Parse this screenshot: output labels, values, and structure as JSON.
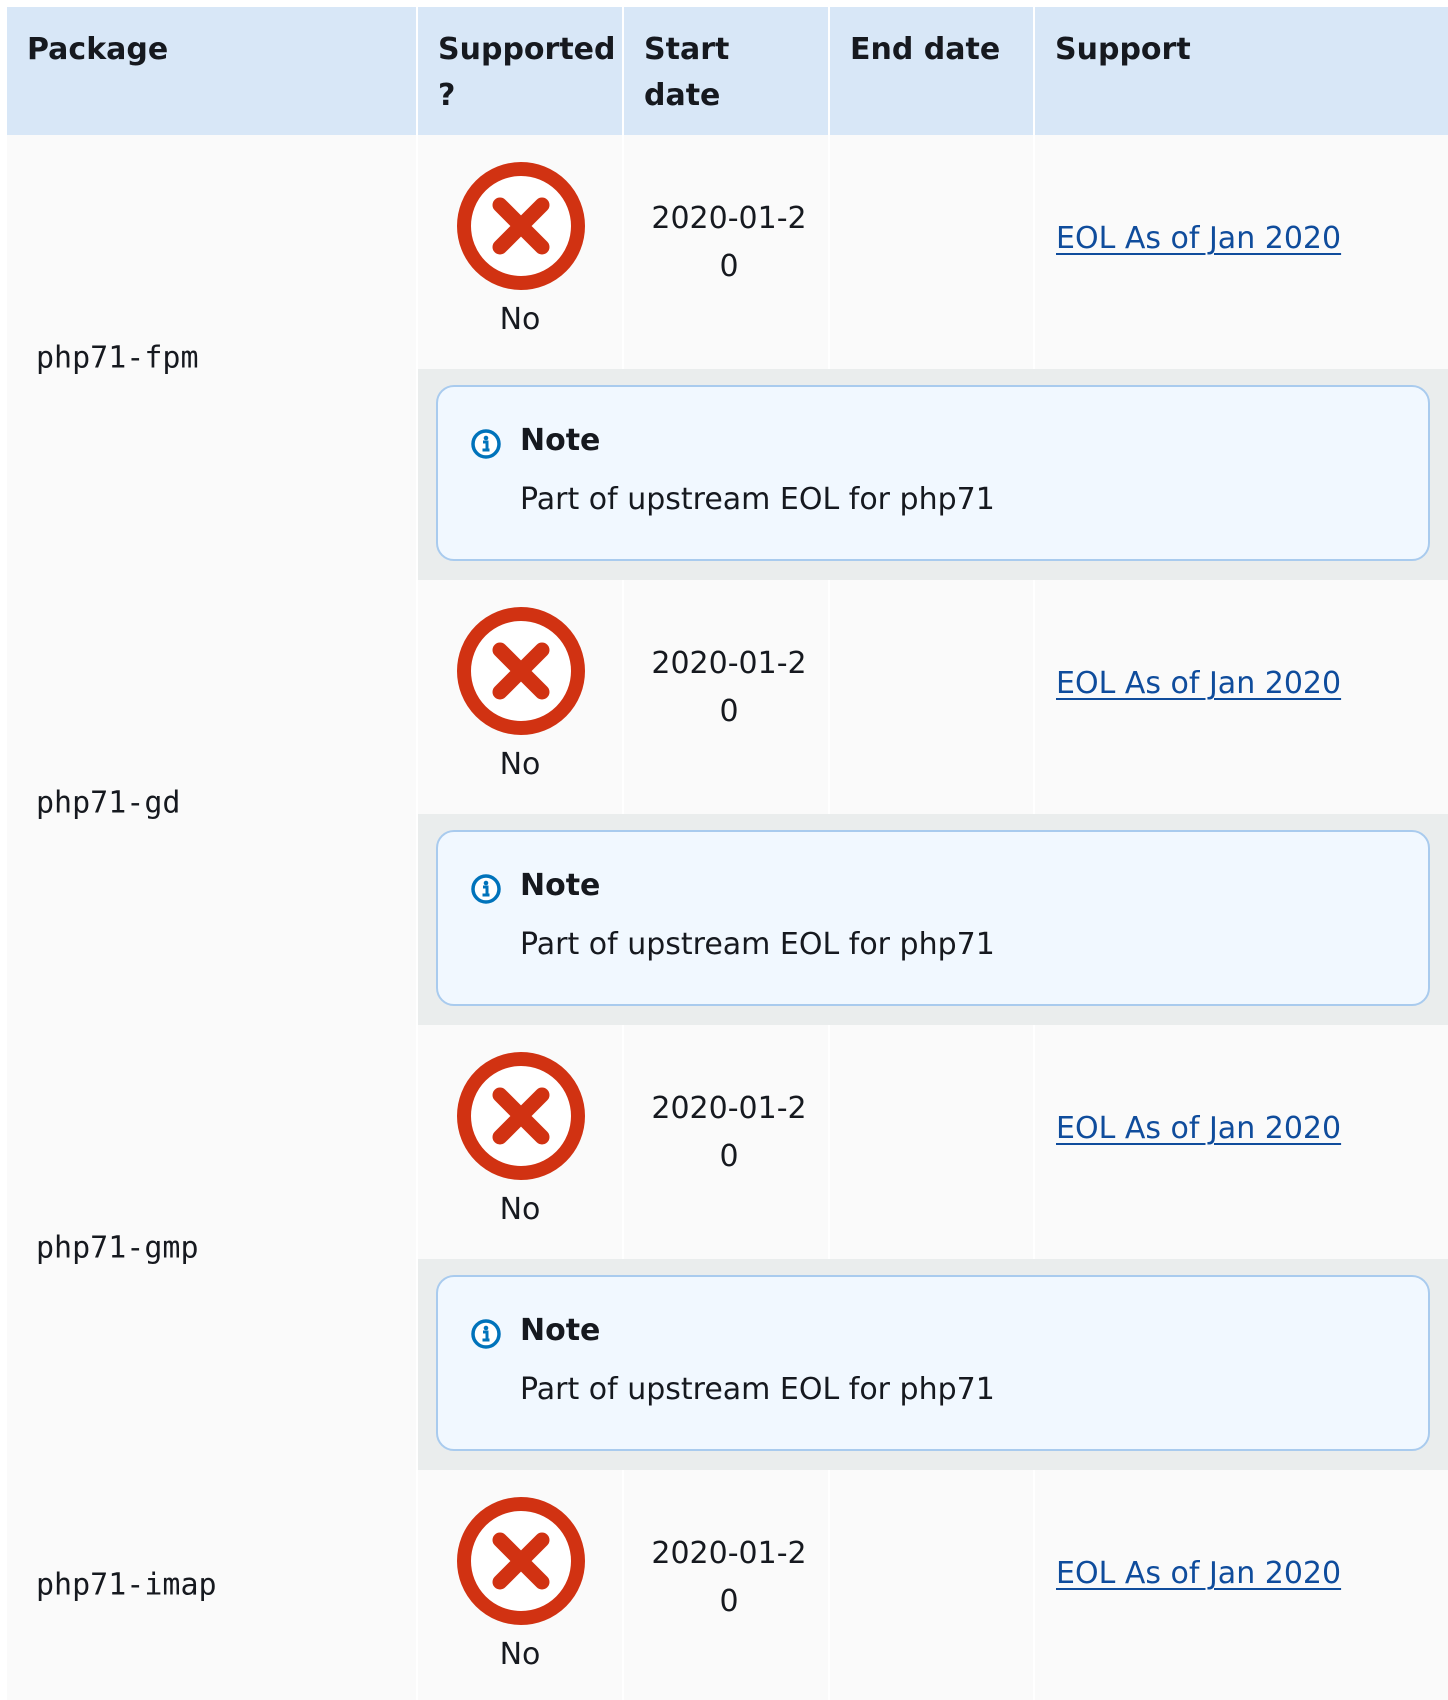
{
  "table": {
    "headers": {
      "package": "Package",
      "supported": "Supported ?",
      "start_date": "Start date",
      "end_date": "End date",
      "support": "Support"
    },
    "rows": [
      {
        "package": "php71-fpm",
        "supported": "No",
        "supported_icon": "x-circle-icon",
        "start_date": "2020-01-20",
        "end_date": "",
        "support_link": "EOL As of Jan 2020",
        "note_title": "Note",
        "note_text": "Part of upstream EOL for php71"
      },
      {
        "package": "php71-gd",
        "supported": "No",
        "supported_icon": "x-circle-icon",
        "start_date": "2020-01-20",
        "end_date": "",
        "support_link": "EOL As of Jan 2020",
        "note_title": "Note",
        "note_text": "Part of upstream EOL for php71"
      },
      {
        "package": "php71-gmp",
        "supported": "No",
        "supported_icon": "x-circle-icon",
        "start_date": "2020-01-20",
        "end_date": "",
        "support_link": "EOL As of Jan 2020",
        "note_title": "Note",
        "note_text": "Part of upstream EOL for php71"
      },
      {
        "package": "php71-imap",
        "supported": "No",
        "supported_icon": "x-circle-icon",
        "start_date": "2020-01-20",
        "end_date": "",
        "support_link": "EOL As of Jan 2020"
      }
    ]
  },
  "colors": {
    "header_bg": "#d8e7f7",
    "row_bg": "#fafafa",
    "note_cell_bg": "#eaeded",
    "note_box_bg": "#f1f8ff",
    "note_border": "#a9cbee",
    "link": "#0f4c9c",
    "x_icon": "#d13212",
    "info_icon": "#0073bb"
  }
}
